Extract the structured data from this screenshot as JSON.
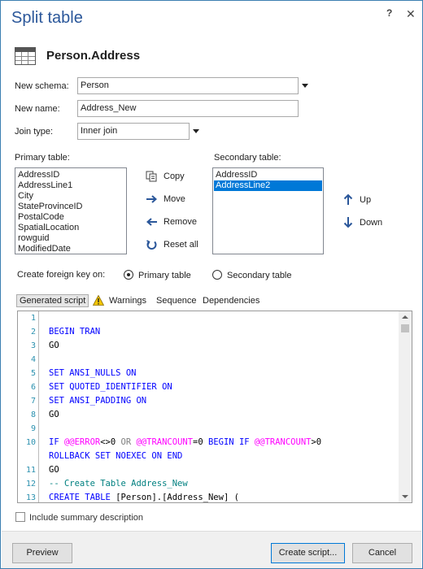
{
  "dialog": {
    "title": "Split table",
    "help_label": "?",
    "close_label": "✕"
  },
  "object": {
    "name": "Person.Address",
    "icon": "table-icon"
  },
  "form": {
    "new_schema_label": "New schema:",
    "new_schema_value": "Person",
    "new_name_label": "New name:",
    "new_name_value": "Address_New",
    "join_type_label": "Join type:",
    "join_type_value": "Inner join"
  },
  "primary": {
    "label": "Primary table:",
    "items": [
      "AddressID",
      "AddressLine1",
      "City",
      "StateProvinceID",
      "PostalCode",
      "SpatialLocation",
      "rowguid",
      "ModifiedDate"
    ]
  },
  "secondary": {
    "label": "Secondary table:",
    "items": [
      "AddressID",
      "AddressLine2"
    ],
    "selected": "AddressLine2"
  },
  "actions": {
    "copy": "Copy",
    "move": "Move",
    "remove": "Remove",
    "reset_all": "Reset all",
    "up": "Up",
    "down": "Down"
  },
  "foreign_key": {
    "label": "Create foreign key on:",
    "primary_option": "Primary table",
    "secondary_option": "Secondary table",
    "selected": "Primary table"
  },
  "tabs": {
    "generated_script": "Generated script",
    "warnings": "Warnings",
    "sequence": "Sequence",
    "dependencies": "Dependencies"
  },
  "script": {
    "lines": [
      {
        "n": "1",
        "parts": []
      },
      {
        "n": "2",
        "parts": [
          {
            "t": "BEGIN TRAN",
            "c": "kw"
          }
        ]
      },
      {
        "n": "3",
        "parts": [
          {
            "t": "GO",
            "c": ""
          }
        ]
      },
      {
        "n": "4",
        "parts": []
      },
      {
        "n": "5",
        "parts": [
          {
            "t": "SET ANSI_NULLS ON",
            "c": "kw"
          }
        ]
      },
      {
        "n": "6",
        "parts": [
          {
            "t": "SET QUOTED_IDENTIFIER ON",
            "c": "kw"
          }
        ]
      },
      {
        "n": "7",
        "parts": [
          {
            "t": "SET ANSI_PADDING ON",
            "c": "kw"
          }
        ]
      },
      {
        "n": "8",
        "parts": [
          {
            "t": "GO",
            "c": ""
          }
        ]
      },
      {
        "n": "9",
        "parts": []
      },
      {
        "n": "10",
        "parts": [
          {
            "t": "IF ",
            "c": "kw"
          },
          {
            "t": "@@ERROR",
            "c": "fn"
          },
          {
            "t": "<>0 ",
            "c": ""
          },
          {
            "t": "OR ",
            "c": "gr"
          },
          {
            "t": "@@TRANCOUNT",
            "c": "fn"
          },
          {
            "t": "=0 ",
            "c": ""
          },
          {
            "t": "BEGIN IF ",
            "c": "kw"
          },
          {
            "t": "@@TRANCOUNT",
            "c": "fn"
          },
          {
            "t": ">0",
            "c": ""
          }
        ]
      },
      {
        "n": "",
        "parts": [
          {
            "t": "ROLLBACK SET NOEXEC ON END",
            "c": "kw"
          }
        ]
      },
      {
        "n": "11",
        "parts": [
          {
            "t": "GO",
            "c": ""
          }
        ]
      },
      {
        "n": "12",
        "parts": [
          {
            "t": "-- Create Table Address_New",
            "c": "cm"
          }
        ]
      },
      {
        "n": "13",
        "parts": [
          {
            "t": "CREATE TABLE ",
            "c": "kw"
          },
          {
            "t": "[Person].[Address_New] (",
            "c": ""
          }
        ]
      }
    ]
  },
  "summary": {
    "label": "Include summary description",
    "checked": false
  },
  "footer": {
    "preview": "Preview",
    "create_script": "Create script...",
    "cancel": "Cancel"
  }
}
